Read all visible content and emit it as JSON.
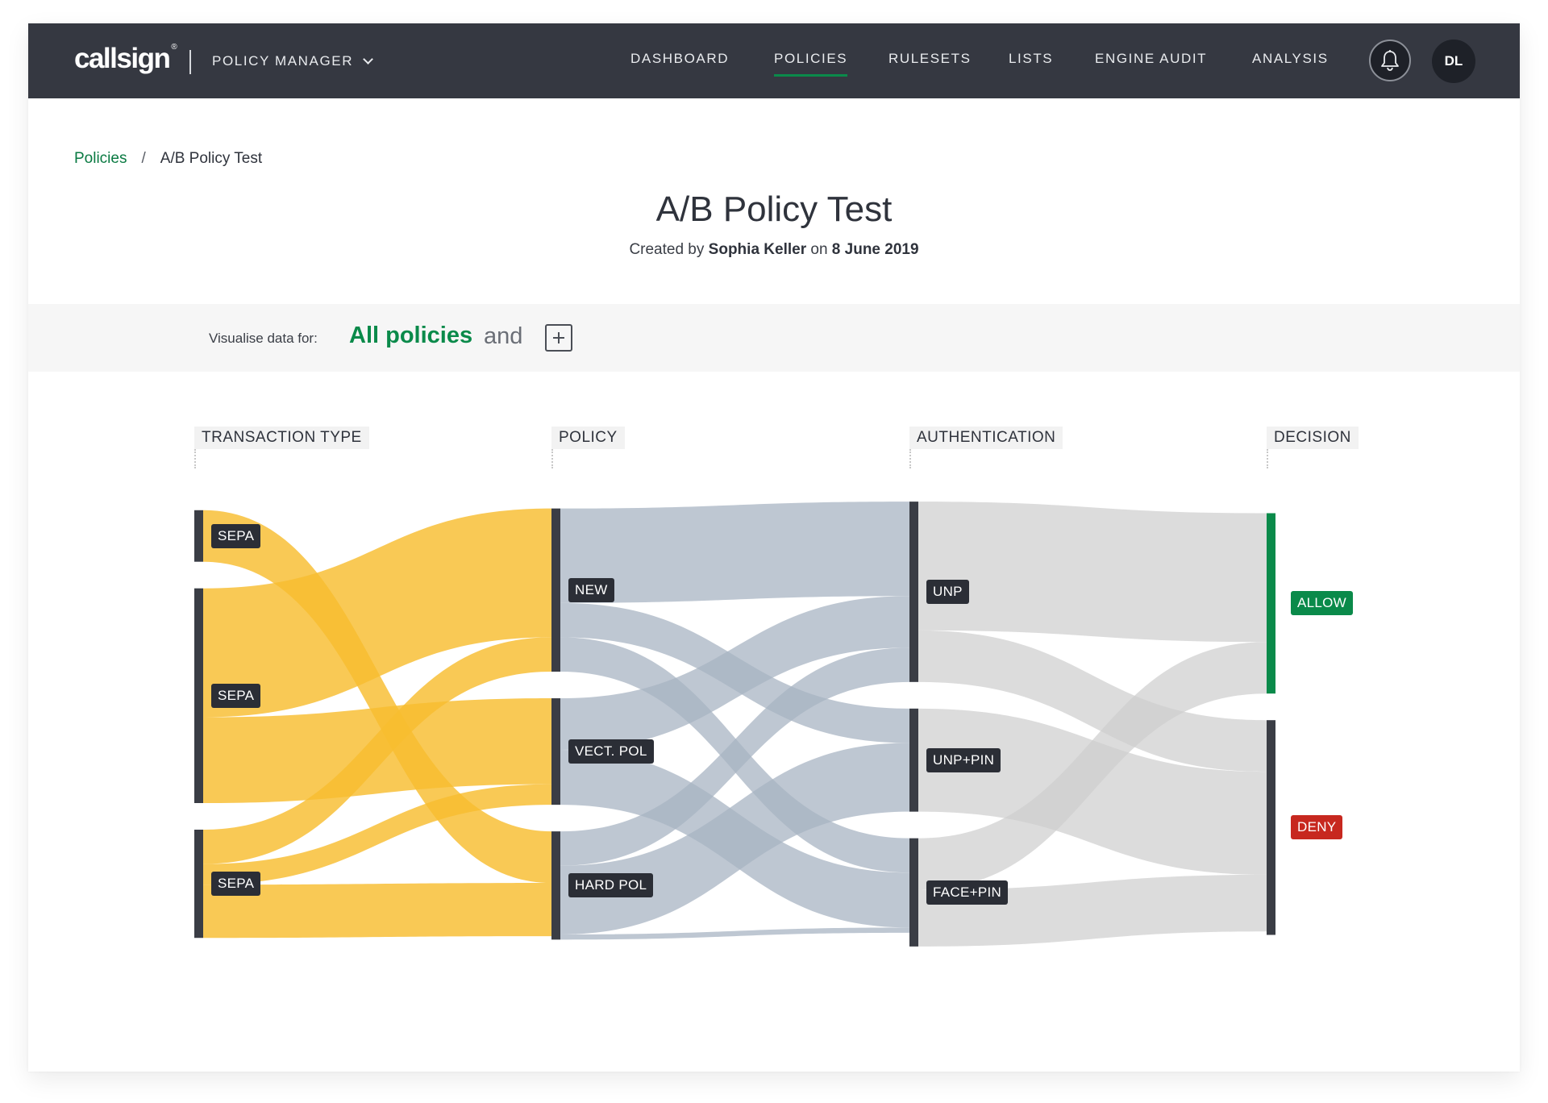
{
  "brand": {
    "logo_text": "callsign",
    "logo_mark": "®"
  },
  "app_switcher": {
    "label": "POLICY MANAGER",
    "icon": "chevron-down-icon"
  },
  "nav": [
    {
      "label": "DASHBOARD",
      "active": false
    },
    {
      "label": "POLICIES",
      "active": true
    },
    {
      "label": "RULESETS",
      "active": false
    },
    {
      "label": "LISTS",
      "active": false
    },
    {
      "label": "ENGINE AUDIT",
      "active": false
    },
    {
      "label": "ANALYSIS",
      "active": false
    }
  ],
  "notifications": {
    "icon": "bell-icon"
  },
  "user": {
    "initials": "DL"
  },
  "breadcrumb": {
    "parent": "Policies",
    "separator": "/",
    "current": "A/B Policy Test"
  },
  "page": {
    "title": "A/B Policy Test",
    "created_prefix": "Created by",
    "author": "Sophia Keller",
    "created_on": "on",
    "date": "8 June 2019"
  },
  "filter": {
    "label": "Visualise data for:",
    "selected": "All policies",
    "conjunction": "and",
    "add_icon": "plus-icon"
  },
  "colors": {
    "accent_green": "#0a8a4a",
    "deny_red": "#c7281f",
    "flow_yellow": "#f8bd2f",
    "flow_blue": "#a7b4c2",
    "flow_grey": "#cfcfcf",
    "node_bar": "#3a3d45"
  },
  "chart_data": {
    "type": "sankey",
    "stages": [
      "TRANSACTION TYPE",
      "POLICY",
      "AUTHENTICATION",
      "DECISION"
    ],
    "nodes": [
      {
        "id": "t1",
        "label": "SEPA",
        "stage": 0,
        "value": 3
      },
      {
        "id": "t2",
        "label": "SEPA",
        "stage": 0,
        "value": 12.5
      },
      {
        "id": "t3",
        "label": "SEPA",
        "stage": 0,
        "value": 6.3
      },
      {
        "id": "p_new",
        "label": "NEW",
        "stage": 1,
        "value": 9.5
      },
      {
        "id": "p_vect",
        "label": "VECT. POL",
        "stage": 1,
        "value": 6.2
      },
      {
        "id": "p_hard",
        "label": "HARD POL",
        "stage": 1,
        "value": 6.3
      },
      {
        "id": "a_unp",
        "label": "UNP",
        "stage": 2,
        "value": 10.5
      },
      {
        "id": "a_unppin",
        "label": "UNP+PIN",
        "stage": 2,
        "value": 6
      },
      {
        "id": "a_face",
        "label": "FACE+PIN",
        "stage": 2,
        "value": 6.3
      },
      {
        "id": "d_allow",
        "label": "ALLOW",
        "stage": 3,
        "value": 10.5
      },
      {
        "id": "d_deny",
        "label": "DENY",
        "stage": 3,
        "value": 12.5
      }
    ],
    "links": [
      {
        "source": "t1",
        "target": "p_hard",
        "value": 3
      },
      {
        "source": "t2",
        "target": "p_new",
        "value": 7.5
      },
      {
        "source": "t2",
        "target": "p_vect",
        "value": 5
      },
      {
        "source": "t3",
        "target": "p_new",
        "value": 2
      },
      {
        "source": "t3",
        "target": "p_vect",
        "value": 1.2
      },
      {
        "source": "t3",
        "target": "p_hard",
        "value": 3.1
      },
      {
        "source": "p_new",
        "target": "a_unp",
        "value": 5.5
      },
      {
        "source": "p_new",
        "target": "a_unppin",
        "value": 2
      },
      {
        "source": "p_new",
        "target": "a_face",
        "value": 2
      },
      {
        "source": "p_vect",
        "target": "a_unp",
        "value": 3
      },
      {
        "source": "p_vect",
        "target": "a_face",
        "value": 3.2
      },
      {
        "source": "p_hard",
        "target": "a_unp",
        "value": 2
      },
      {
        "source": "p_hard",
        "target": "a_unppin",
        "value": 4
      },
      {
        "source": "p_hard",
        "target": "a_face",
        "value": 0.3
      },
      {
        "source": "a_unp",
        "target": "d_allow",
        "value": 7.5
      },
      {
        "source": "a_unp",
        "target": "d_deny",
        "value": 3
      },
      {
        "source": "a_unppin",
        "target": "d_deny",
        "value": 6
      },
      {
        "source": "a_face",
        "target": "d_allow",
        "value": 3
      },
      {
        "source": "a_face",
        "target": "d_deny",
        "value": 3.3
      }
    ]
  }
}
